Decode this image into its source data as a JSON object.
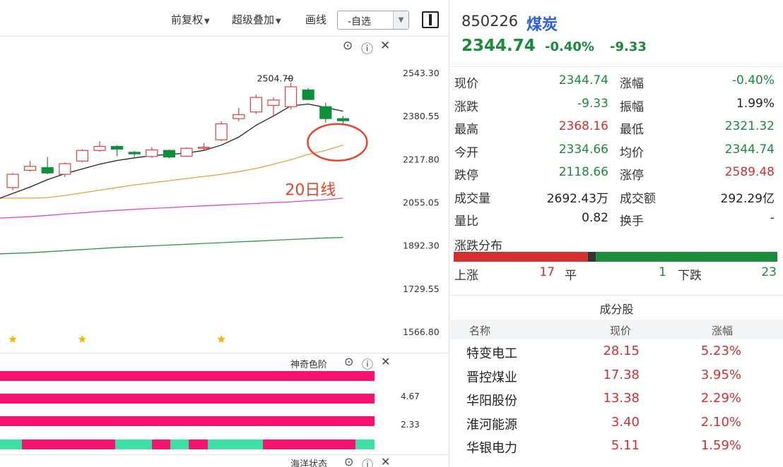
{
  "toolbar": {
    "adjust_label": "前复权",
    "overlay_label": "超级叠加",
    "draw_label": "画线",
    "select_value": "-自选"
  },
  "chart_data": {
    "type": "candlestick",
    "ylim": [
      1566.8,
      2543.3
    ],
    "y_ticks": [
      "2543.30",
      "2380.55",
      "2217.80",
      "2055.05",
      "1892.30",
      "1729.55",
      "1566.80"
    ],
    "high_label": "2504.70",
    "annotation": "20日线",
    "candles": [
      {
        "o": 2110,
        "c": 2160,
        "h": 2165,
        "l": 2100
      },
      {
        "o": 2175,
        "c": 2190,
        "h": 2210,
        "l": 2170
      },
      {
        "o": 2185,
        "c": 2165,
        "h": 2225,
        "l": 2160
      },
      {
        "o": 2160,
        "c": 2200,
        "h": 2205,
        "l": 2150
      },
      {
        "o": 2210,
        "c": 2250,
        "h": 2255,
        "l": 2205
      },
      {
        "o": 2250,
        "c": 2265,
        "h": 2285,
        "l": 2245
      },
      {
        "o": 2265,
        "c": 2255,
        "h": 2270,
        "l": 2228
      },
      {
        "o": 2243,
        "c": 2237,
        "h": 2248,
        "l": 2225
      },
      {
        "o": 2227,
        "c": 2252,
        "h": 2262,
        "l": 2222
      },
      {
        "o": 2250,
        "c": 2225,
        "h": 2253,
        "l": 2220
      },
      {
        "o": 2228,
        "c": 2258,
        "h": 2262,
        "l": 2228
      },
      {
        "o": 2258,
        "c": 2262,
        "h": 2278,
        "l": 2252
      },
      {
        "o": 2290,
        "c": 2350,
        "h": 2360,
        "l": 2285
      },
      {
        "o": 2370,
        "c": 2385,
        "h": 2410,
        "l": 2360
      },
      {
        "o": 2395,
        "c": 2450,
        "h": 2460,
        "l": 2388
      },
      {
        "o": 2420,
        "c": 2440,
        "h": 2450,
        "l": 2380
      },
      {
        "o": 2415,
        "c": 2490,
        "h": 2505,
        "l": 2405
      },
      {
        "o": 2478,
        "c": 2442,
        "h": 2485,
        "l": 2440
      },
      {
        "o": 2415,
        "c": 2370,
        "h": 2430,
        "l": 2355
      },
      {
        "o": 2370,
        "c": 2362,
        "h": 2380,
        "l": 2345
      }
    ],
    "ma_fast": [
      2070,
      2112,
      2140,
      2162,
      2180,
      2198,
      2212,
      2222,
      2230,
      2235,
      2240,
      2250,
      2270,
      2300,
      2345,
      2380,
      2418,
      2425,
      2412,
      2398
    ],
    "ma20": [
      2070,
      2070,
      2072,
      2080,
      2090,
      2100,
      2110,
      2120,
      2128,
      2136,
      2144,
      2152,
      2160,
      2170,
      2182,
      2198,
      2215,
      2235,
      2250,
      2270
    ],
    "ma_pink": [
      1995,
      2000,
      2005,
      2010,
      2015,
      2020,
      2024,
      2028,
      2031,
      2034,
      2038,
      2041,
      2044,
      2047,
      2050,
      2053,
      2056,
      2060,
      2064,
      2070
    ],
    "ma_green": [
      1860,
      1864,
      1868,
      1872,
      1876,
      1880,
      1884,
      1887,
      1890,
      1893,
      1896,
      1899,
      1902,
      1905,
      1908,
      1911,
      1914,
      1917,
      1920,
      1922
    ],
    "star_candles": [
      0,
      4,
      12
    ]
  },
  "indicator": {
    "name": "神奇色阶",
    "values": [
      "4.67",
      "2.33"
    ],
    "bottom_name": "海洋状态"
  },
  "quote": {
    "code": "850226",
    "name": "煤炭",
    "price": "2344.74",
    "pct": "-0.40%",
    "chg": "-9.33",
    "rows": [
      {
        "l1": "现价",
        "v1": "2344.74",
        "c1": "green",
        "l2": "涨幅",
        "v2": "-0.40%",
        "c2": "green"
      },
      {
        "l1": "涨跌",
        "v1": "-9.33",
        "c1": "green",
        "l2": "振幅",
        "v2": "1.99%",
        "c2": "black"
      },
      {
        "l1": "最高",
        "v1": "2368.16",
        "c1": "red",
        "l2": "最低",
        "v2": "2321.32",
        "c2": "green"
      },
      {
        "l1": "今开",
        "v1": "2334.66",
        "c1": "green",
        "l2": "均价",
        "v2": "2344.74",
        "c2": "green"
      },
      {
        "l1": "跌停",
        "v1": "2118.66",
        "c1": "green",
        "l2": "涨停",
        "v2": "2589.48",
        "c2": "red"
      },
      {
        "l1": "成交量",
        "v1": "2692.43万",
        "c1": "black",
        "l2": "成交额",
        "v2": "292.29亿",
        "c2": "black"
      },
      {
        "l1": "量比",
        "v1": "0.82",
        "c1": "black",
        "l2": "换手",
        "v2": "-",
        "c2": "black"
      }
    ],
    "distribution": {
      "title": "涨跌分布",
      "up_label": "上涨",
      "up_count": 17,
      "flat_label": "平",
      "flat_count": 1,
      "down_label": "下跌",
      "down_count": 23
    },
    "constituents": {
      "title": "成分股",
      "headers": [
        "名称",
        "现价",
        "涨幅"
      ],
      "rows": [
        {
          "name": "特变电工",
          "price": "28.15",
          "chg": "5.23%"
        },
        {
          "name": "晋控煤业",
          "price": "17.38",
          "chg": "3.95%"
        },
        {
          "name": "华阳股份",
          "price": "13.38",
          "chg": "2.29%"
        },
        {
          "name": "淮河能源",
          "price": "3.40",
          "chg": "2.10%"
        },
        {
          "name": "华银电力",
          "price": "5.11",
          "chg": "1.59%"
        }
      ]
    }
  },
  "colors": {
    "red": "#d32f2f",
    "green": "#1a8a3b",
    "black": "#222222",
    "candle_up": "#e0403f",
    "candle_down": "#0e8f3a",
    "ma_fast": "#222222",
    "ma20": "#e8a040",
    "ma_pink": "#d948d4",
    "ma_green": "#2a9a3a",
    "indicator_pink": "#f2146e",
    "indicator_teal": "#3de0a4",
    "ellipse": "#e8432a",
    "star": "#f5b400"
  }
}
